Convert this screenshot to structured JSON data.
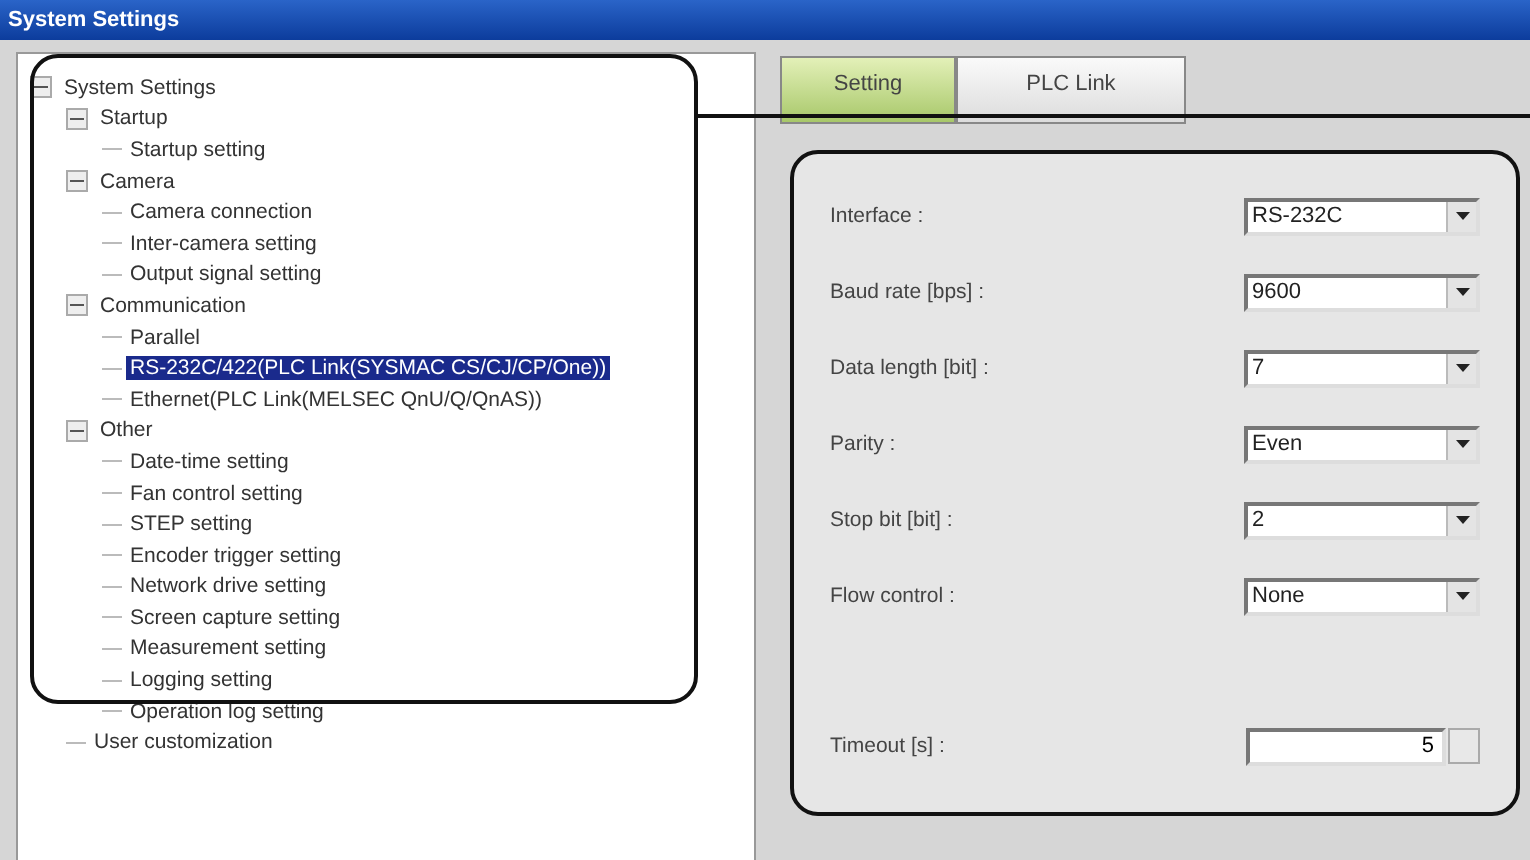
{
  "window": {
    "title": "System Settings"
  },
  "tree": [
    {
      "label": "System Settings",
      "expanded": true,
      "selected": false,
      "children": [
        {
          "label": "Startup",
          "expanded": true,
          "selected": false,
          "children": [
            {
              "label": "Startup setting",
              "selected": false
            }
          ]
        },
        {
          "label": "Camera",
          "expanded": true,
          "selected": false,
          "children": [
            {
              "label": "Camera connection",
              "selected": false
            },
            {
              "label": "Inter-camera setting",
              "selected": false
            },
            {
              "label": "Output signal setting",
              "selected": false
            }
          ]
        },
        {
          "label": "Communication",
          "expanded": true,
          "selected": false,
          "children": [
            {
              "label": "Parallel",
              "selected": false
            },
            {
              "label": "RS-232C/422(PLC Link(SYSMAC CS/CJ/CP/One))",
              "selected": true
            },
            {
              "label": "Ethernet(PLC Link(MELSEC QnU/Q/QnAS))",
              "selected": false
            }
          ]
        },
        {
          "label": "Other",
          "expanded": true,
          "selected": false,
          "children": [
            {
              "label": "Date-time setting",
              "selected": false
            },
            {
              "label": "Fan control setting",
              "selected": false
            },
            {
              "label": "STEP setting",
              "selected": false
            },
            {
              "label": "Encoder trigger setting",
              "selected": false
            },
            {
              "label": "Network drive setting",
              "selected": false
            },
            {
              "label": "Screen capture setting",
              "selected": false
            },
            {
              "label": "Measurement setting",
              "selected": false
            },
            {
              "label": "Logging setting",
              "selected": false
            },
            {
              "label": "Operation log setting",
              "selected": false
            }
          ]
        },
        {
          "label": "User customization",
          "selected": false
        }
      ]
    }
  ],
  "tabs": [
    {
      "label": "Setting",
      "selected": true
    },
    {
      "label": "PLC Link",
      "selected": false
    }
  ],
  "fields": [
    {
      "kind": "dropdown",
      "label": "Interface :",
      "value": "RS-232C"
    },
    {
      "kind": "dropdown",
      "label": "Baud rate [bps] :",
      "value": "9600"
    },
    {
      "kind": "dropdown",
      "label": "Data length [bit] :",
      "value": "7"
    },
    {
      "kind": "dropdown",
      "label": "Parity :",
      "value": "Even"
    },
    {
      "kind": "dropdown",
      "label": "Stop bit [bit] :",
      "value": "2"
    },
    {
      "kind": "dropdown",
      "label": "Flow control :",
      "value": "None"
    },
    {
      "kind": "spinner",
      "label": "Timeout [s] :",
      "value": "5"
    }
  ]
}
